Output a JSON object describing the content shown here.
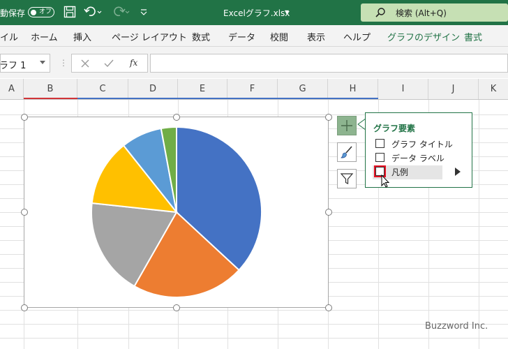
{
  "titlebar": {
    "autosave_label": "動保存",
    "toggle_state": "オフ",
    "file_name": "Excelグラフ.xlsx",
    "file_dropdown": "▾",
    "search_text": "検索 (Alt+Q)"
  },
  "ribbon": {
    "tabs": [
      "イル",
      "ホーム",
      "挿入",
      "ページ レイアウト",
      "数式",
      "データ",
      "校閲",
      "表示",
      "ヘルプ",
      "グラフのデザイン",
      "書式"
    ]
  },
  "formula_bar": {
    "name_box": "ラフ 1",
    "fx_label": "fx"
  },
  "columns": [
    "A",
    "B",
    "C",
    "D",
    "E",
    "F",
    "G",
    "H",
    "I",
    "J",
    "K"
  ],
  "chart_elements": {
    "title": "グラフ要素",
    "items": [
      {
        "label": "グラフ タイトル",
        "checked": false
      },
      {
        "label": "データ ラベル",
        "checked": false
      },
      {
        "label": "凡例",
        "checked": false
      }
    ]
  },
  "chart_data": {
    "type": "pie",
    "values": [
      38,
      22,
      19,
      13,
      8,
      3
    ],
    "colors": [
      "#4472c4",
      "#ed7d31",
      "#a5a5a5",
      "#ffc000",
      "#5b9bd5",
      "#70ad47"
    ]
  },
  "watermark": "Buzzword Inc."
}
